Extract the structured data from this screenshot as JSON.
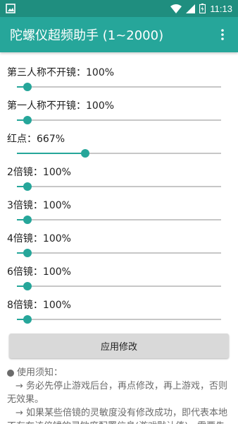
{
  "status_bar": {
    "time": "11:13",
    "icons": [
      "image-icon",
      "wifi-icon",
      "signal-icon",
      "battery-icon"
    ]
  },
  "app_bar": {
    "title": "陀螺仪超频助手 (1~2000)",
    "menu_icon": "more-vert-icon"
  },
  "settings": [
    {
      "label": "第三人称不开镜：100%",
      "level": 0.05
    },
    {
      "label": "第一人称不开镜：100%",
      "level": 0.05
    },
    {
      "label": "红点：667%",
      "level": 0.333
    },
    {
      "label": "2倍镜：100%",
      "level": 0.05
    },
    {
      "label": "3倍镜：100%",
      "level": 0.05
    },
    {
      "label": "4倍镜：100%",
      "level": 0.05
    },
    {
      "label": "6倍镜：100%",
      "level": 0.05
    },
    {
      "label": "8倍镜：100%",
      "level": 0.05
    }
  ],
  "apply_button": "应用修改",
  "notes": {
    "heading": "使用须知：",
    "items": [
      "→ 务必先停止游戏后台，再点修改，再上游戏，否则无效果。",
      "→ 如果某些倍镜的灵敏度没有修改成功，即代表本地不存在该倍镜的灵敏度配置信息(游戏默认值)，需要先"
    ]
  },
  "colors": {
    "status_bar": "#1f8e7f",
    "app_bar": "#26a69a",
    "accent": "#26a69a",
    "apply_button": "#d9d9d9"
  }
}
